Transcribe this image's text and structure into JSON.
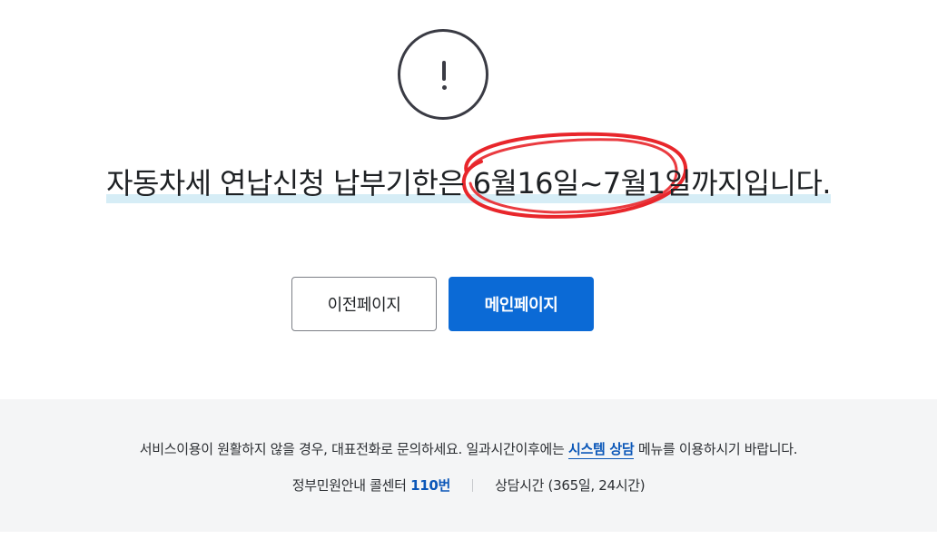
{
  "alert": {
    "icon": "exclamation-circle-icon"
  },
  "headline": {
    "text": "자동차세 연납신청 납부기한은 6월16일~7월1일까지입니다."
  },
  "annotation": {
    "color": "#e8262b"
  },
  "buttons": {
    "prev_label": "이전페이지",
    "main_label": "메인페이지"
  },
  "footer": {
    "notice_before": "서비스이용이 원활하지 않을 경우, 대표전화로 문의하세요. 일과시간이후에는 ",
    "notice_link": "시스템 상담",
    "notice_after": " 메뉴를 이용하시기 바랍니다.",
    "call_center_label": "정부민원안내 콜센터 ",
    "call_center_number": "110번",
    "hours": "상담시간 (365일, 24시간)"
  },
  "colors": {
    "primary": "#0b6ad6",
    "link": "#0b57b8",
    "highlight": "#d6edf6",
    "footer_bg": "#f4f5f6"
  }
}
